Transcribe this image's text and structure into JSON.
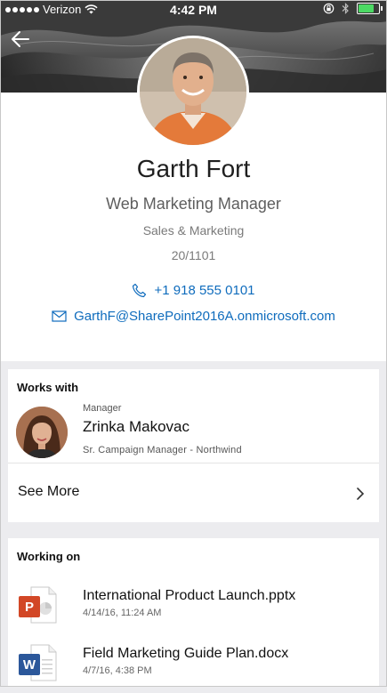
{
  "status_bar": {
    "carrier": "Verizon",
    "time": "4:42 PM",
    "battery_level": 0.7,
    "battery_color": "#4cd964"
  },
  "header": {
    "back_icon": "arrow-left-icon"
  },
  "profile": {
    "name": "Garth Fort",
    "job_title": "Web Marketing Manager",
    "department": "Sales & Marketing",
    "office": "20/1101",
    "phone": "+1 918 555 0101",
    "email": "GarthF@SharePoint2016A.onmicrosoft.com",
    "link_color": "#0f6cbd"
  },
  "works_with": {
    "heading": "Works with",
    "colleague": {
      "relationship": "Manager",
      "name": "Zrinka Makovac",
      "subtitle": "Sr. Campaign Manager - Northwind"
    },
    "see_more_label": "See More"
  },
  "working_on": {
    "heading": "Working on",
    "files": [
      {
        "name": "International Product Launch.pptx",
        "date": "4/14/16, 11:24 AM",
        "type": "powerpoint",
        "icon": "powerpoint-icon",
        "badge_letter": "P",
        "color": "#d24726"
      },
      {
        "name": "Field Marketing Guide Plan.docx",
        "date": "4/7/16, 4:38 PM",
        "type": "word",
        "icon": "word-icon",
        "badge_letter": "W",
        "color": "#2b579a"
      }
    ]
  }
}
